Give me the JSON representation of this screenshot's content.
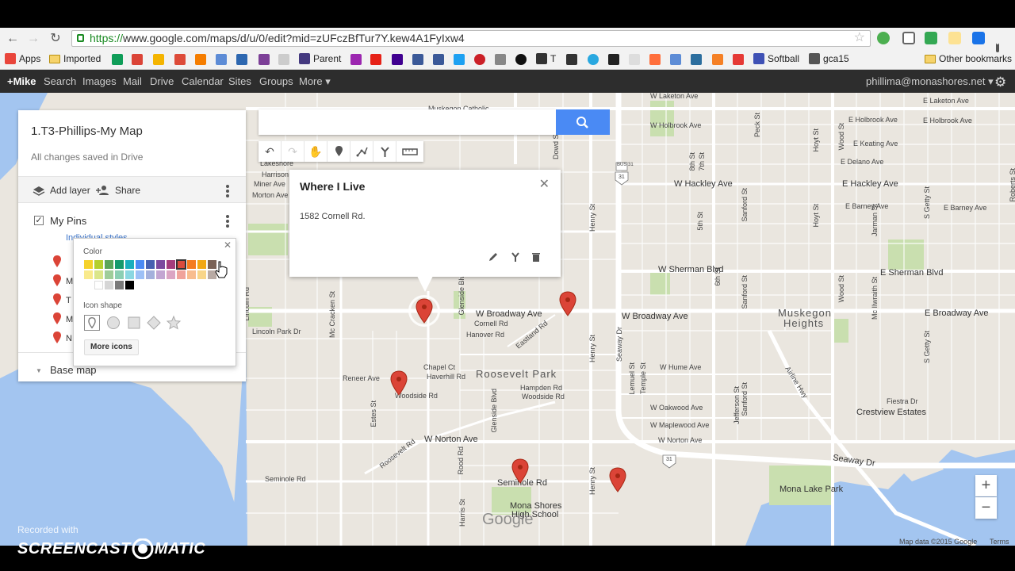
{
  "browser": {
    "url_https": "https://",
    "url_rest": "www.google.com/maps/d/u/0/edit?mid=zUFczBfTur7Y.kew4A1FyIxw4",
    "bookmarks": [
      "Apps",
      "Imported",
      "Parent",
      "T",
      "Softball",
      "gca15",
      "Other bookmarks"
    ]
  },
  "google_bar": {
    "items": [
      "+Mike",
      "Search",
      "Images",
      "Mail",
      "Drive",
      "Calendar",
      "Sites",
      "Groups",
      "More ▾"
    ],
    "account": "phillima@monashores.net ▾"
  },
  "panel": {
    "title": "1.T3-Phillips-My Map",
    "subtitle": "All changes saved in Drive",
    "add_layer": "Add layer",
    "share": "Share",
    "layer_name": "My Pins",
    "styles_link": "Individual styles",
    "list_items": [
      "M",
      "T",
      "M",
      "N"
    ],
    "base_map": "Base map"
  },
  "color_popup": {
    "color_heading": "Color",
    "shape_heading": "Icon shape",
    "more_icons": "More icons",
    "palette": [
      "#f5d22b",
      "#b5cf2d",
      "#5aa55a",
      "#159a6c",
      "#18aebd",
      "#4a8af4",
      "#4660b0",
      "#7c4a9e",
      "#a53d7c",
      "#d94b3d",
      "#f47c20",
      "#f2a714",
      "#7a6256",
      "#f9ea8c",
      "#dbe68a",
      "#9fcd9a",
      "#8bcfb3",
      "#8ad7e1",
      "#9dc0f6",
      "#a4b0dc",
      "#c3a5d2",
      "#dba4c3",
      "#f0a39b",
      "#f8bd8e",
      "#f8d589",
      "#b8aaa4",
      "#ffffff",
      "#d6d6d6",
      "#7a7a7a",
      "#000000"
    ]
  },
  "search": {
    "placeholder": ""
  },
  "info_window": {
    "title": "Where I Live",
    "address": "1582 Cornell Rd."
  },
  "map_labels": {
    "muskegon_catholic": "Muskegon Catholic",
    "lakeshore": "Lakeshore",
    "harrison": "Harrison",
    "miner_ave": "Miner Ave",
    "morton_ave": "Morton Ave",
    "lincoln_rd": "Lincoln Rd",
    "lincoln_park_dr": "Lincoln Park Dr",
    "mc_cracken_st": "Mc Cracken St",
    "glenside_blvd": "Glenside Blvd",
    "w_broadway_ave": "W Broadway Ave",
    "cornell_rd": "Cornell Rd",
    "hanover_rd": "Hanover Rd",
    "eastland_rd": "Eastland Rd",
    "roosevelt_park": "Roosevelt Park",
    "chapel_ct": "Chapel Ct",
    "haverhill_rd": "Haverhill Rd",
    "hampden_rd": "Hampden Rd",
    "woodside_rd": "Woodside Rd",
    "reneer_ave": "Reneer Ave",
    "estes_st": "Estes St",
    "w_norton_ave": "W Norton Ave",
    "roosevelt_rd": "Roosevelt Rd",
    "rood_rd": "Rood Rd",
    "seminole_rd": "Seminole Rd",
    "harris_st": "Harris St",
    "mona_shores": "Mona Shores",
    "high_school": "High School",
    "henry_st": "Henry St",
    "seaway_dr": "Seaway Dr",
    "peck_st": "Peck St",
    "w_laketon_ave": "W Laketon Ave",
    "e_laketon_ave": "E Laketon Ave",
    "e_holbrook_ave": "E Holbrook Ave",
    "w_holbrook_ave": "W Holbrook Ave",
    "e_keating_ave": "E Keating Ave",
    "e_delano_ave": "E Delano Ave",
    "w_hackley_ave": "W Hackley Ave",
    "e_hackley_ave": "E Hackley Ave",
    "e_barney_ave": "E Barney Ave",
    "w_sherman_blvd": "W Sherman Blvd",
    "e_sherman_blvd": "E Sherman Blvd",
    "muskegon": "Muskegon",
    "heights": "Heights",
    "w_broadway_ave_east": "W Broadway Ave",
    "e_broadway_ave": "E Broadway Ave",
    "w_hume_ave": "W Hume Ave",
    "w_oakwood_ave": "W Oakwood Ave",
    "w_maplewood_ave": "W Maplewood Ave",
    "w_norton_ave_east": "W Norton Ave",
    "seaway_dr_south": "Seaway Dr",
    "fiestra_dr": "Fiestra Dr",
    "crestview_estates": "Crestview Estates",
    "airline_hwy": "Airline Hwy",
    "mona_lake_park": "Mona Lake Park",
    "sanford_st": "Sanford St",
    "s_getty_st": "S Getty St",
    "jarman_st": "Jarman St",
    "mc_ilwraith_st": "Mc Ilwraith St",
    "wood_st": "Wood St",
    "hoyt_st": "Hoyt St",
    "jefferson_st": "Jefferson St",
    "temple_st": "Temple St",
    "lemuel_st": "Lemuel St",
    "sixth_st": "6th St",
    "fifth_st": "5th St",
    "eighth_st": "8th St",
    "seventh_st": "7th St",
    "bowd_st": "Dowd St",
    "bus31": "BUS 31",
    "us31": "31",
    "seminole_rd_west": "Seminole Rd",
    "mc_fern_rd": "Mc Fern Rd",
    "lemen_st": "Lemen St",
    "roberts_st": "Roberts St"
  },
  "map_controls": {
    "zoom_in": "+",
    "zoom_out": "−"
  },
  "map_footer": {
    "attribution": "Map data ©2015 Google",
    "terms": "Terms",
    "logo": "Google"
  },
  "watermark": {
    "recorded_with": "Recorded with",
    "brand_left": "SCREENCAST",
    "brand_right": "MATIC"
  },
  "colors": {
    "pin_red": "#db4437",
    "accent_blue": "#4a8af4",
    "water": "#a3c5f0",
    "park": "#c9dfaf"
  }
}
